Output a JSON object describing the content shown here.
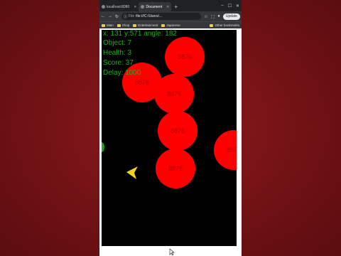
{
  "browser": {
    "tabs": [
      {
        "label": "localhost:8080",
        "active": false
      },
      {
        "label": "Document",
        "active": true
      }
    ],
    "new_tab": "+",
    "window_controls": [
      "–",
      "☐",
      "✕"
    ],
    "address": {
      "scheme": "File",
      "url": "file:///C:/Users/..."
    },
    "update_label": "Update",
    "bookmarks": [
      "Main",
      "Shop",
      "Entertainment",
      "Japanese"
    ],
    "other_bookmarks": "Other bookmarks"
  },
  "hud": {
    "coords": "x: 131 y:571 angle: 182",
    "object": "Object: 7",
    "health": "Health: 3",
    "score": "Score: 37",
    "delay": "Delay: 1000"
  },
  "game": {
    "ball_label": "8876",
    "ball_color": "#ff0000",
    "hud_color": "#1fae1f",
    "player_color": "#f0d020",
    "background": "#000000"
  }
}
